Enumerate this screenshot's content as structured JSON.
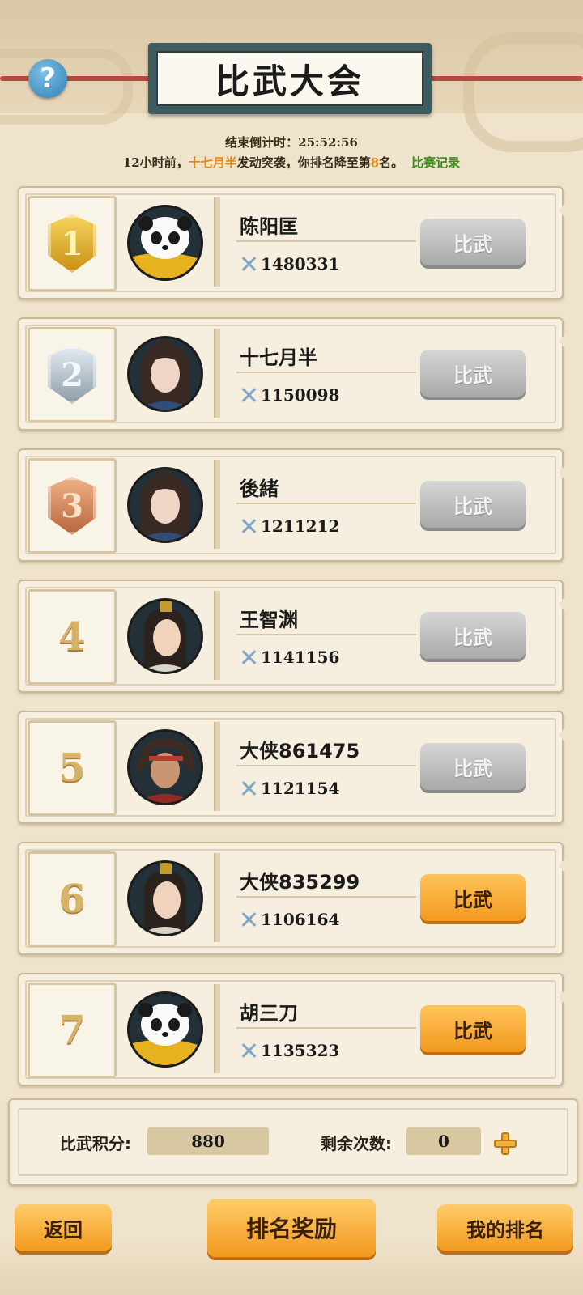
{
  "header": {
    "title": "比武大会",
    "help_label": "?",
    "countdown": "结束倒计时：25:52:56",
    "notice_prefix": "12小时前，",
    "notice_attacker": "十七月半",
    "notice_mid": "发动突袭，你排名降至第",
    "notice_rank": "8",
    "notice_suffix": "名。",
    "record_link": "比赛记录"
  },
  "players": [
    {
      "rank": "1",
      "name": "陈阳匡",
      "power": "1480331",
      "button": "比武",
      "button_state": "disabled",
      "avatar": "panda"
    },
    {
      "rank": "2",
      "name": "十七月半",
      "power": "1150098",
      "button": "比武",
      "button_state": "disabled",
      "avatar": "lady"
    },
    {
      "rank": "3",
      "name": "後緒",
      "power": "1211212",
      "button": "比武",
      "button_state": "disabled",
      "avatar": "lady"
    },
    {
      "rank": "4",
      "name": "王智渊",
      "power": "1141156",
      "button": "比武",
      "button_state": "disabled",
      "avatar": "scholar"
    },
    {
      "rank": "5",
      "name": "大侠861475",
      "power": "1121154",
      "button": "比武",
      "button_state": "disabled",
      "avatar": "warrior"
    },
    {
      "rank": "6",
      "name": "大侠835299",
      "power": "1106164",
      "button": "比武",
      "button_state": "active",
      "avatar": "scholar"
    },
    {
      "rank": "7",
      "name": "胡三刀",
      "power": "1135323",
      "button": "比武",
      "button_state": "active",
      "avatar": "panda"
    }
  ],
  "score": {
    "points_label": "比武积分:",
    "points_value": "880",
    "remaining_label": "剩余次数:",
    "remaining_value": "0"
  },
  "footer": {
    "back": "返回",
    "rewards": "排名奖励",
    "my_rank": "我的排名"
  },
  "colors": {
    "accent_orange": "#f29a1e",
    "disabled_gray": "#a9a9a9",
    "link_green": "#3e8a1e",
    "highlight_orange": "#e08a1a"
  }
}
